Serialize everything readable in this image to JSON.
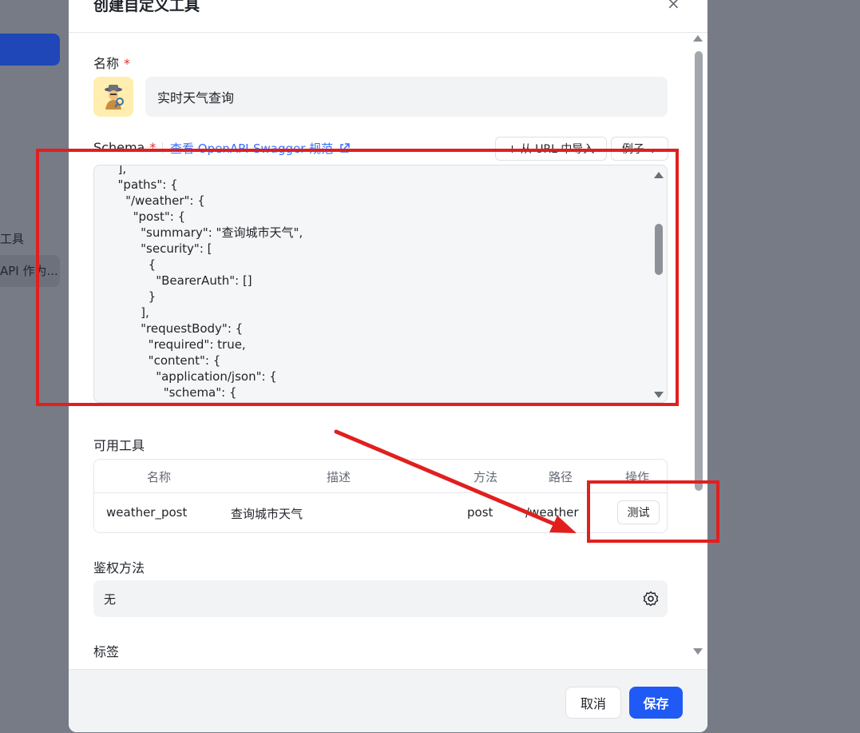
{
  "background": {
    "sidebar_label": "工具",
    "sidebar_item": "API 作为..."
  },
  "dialog": {
    "title": "创建自定义工具",
    "close_glyph": "×"
  },
  "name_field": {
    "label": "名称",
    "required_mark": "*",
    "value": "实时天气查询",
    "avatar_icon": "detective-icon"
  },
  "schema": {
    "label": "Schema",
    "required_mark": "*",
    "link_text": "查看 OpenAPI-Swagger 规范",
    "import_url_label": "+ 从 URL 中导入",
    "example_label": "例子 ⌄",
    "code": "  ],\n  \"paths\": {\n    \"/weather\": {\n      \"post\": {\n        \"summary\": \"查询城市天气\",\n        \"security\": [\n          {\n            \"BearerAuth\": []\n          }\n        ],\n        \"requestBody\": {\n          \"required\": true,\n          \"content\": {\n            \"application/json\": {\n              \"schema\": {"
  },
  "tools": {
    "label": "可用工具",
    "columns": [
      "名称",
      "描述",
      "方法",
      "路径",
      "操作"
    ],
    "rows": [
      {
        "name": "weather_post",
        "description": "查询城市天气",
        "method": "post",
        "path": "/weather",
        "action": "测试"
      }
    ]
  },
  "auth": {
    "label": "鉴权方法",
    "value": "无"
  },
  "tags": {
    "label": "标签"
  },
  "footer": {
    "cancel_label": "取消",
    "save_label": "保存"
  },
  "colors": {
    "primary": "#1f5af5",
    "link": "#3370ff",
    "annotation": "#e11f1f",
    "overlay": "#767b86"
  }
}
